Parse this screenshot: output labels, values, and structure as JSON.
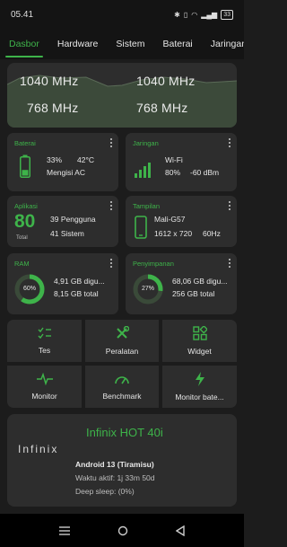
{
  "status_bar": {
    "time": "05.41",
    "icons": [
      "bluetooth-icon",
      "vibrate-icon",
      "wifi-icon",
      "signal-icon",
      "battery-icon"
    ],
    "battery": "33"
  },
  "tabs": [
    {
      "label": "Dasbor",
      "active": true
    },
    {
      "label": "Hardware",
      "active": false
    },
    {
      "label": "Sistem",
      "active": false
    },
    {
      "label": "Baterai",
      "active": false
    },
    {
      "label": "Jaringan",
      "active": false
    }
  ],
  "cpu_freq": {
    "values": [
      "1040 MHz",
      "1040 MHz",
      "768 MHz",
      "768 MHz"
    ]
  },
  "battery_card": {
    "title": "Baterai",
    "percent": "33%",
    "temp": "42°C",
    "status": "Mengisi AC",
    "level": 0.33
  },
  "network_card": {
    "title": "Jaringan",
    "type": "Wi-Fi",
    "signal": "80%",
    "dbm": "-60 dBm"
  },
  "apps_card": {
    "title": "Aplikasi",
    "total": "80",
    "total_label": "Total",
    "user": "39 Pengguna",
    "system": "41 Sistem"
  },
  "display_card": {
    "title": "Tampilan",
    "gpu": "Mali-G57",
    "resolution": "1612 x 720",
    "refresh": "60Hz"
  },
  "ram_card": {
    "title": "RAM",
    "percent": "60%",
    "level": 0.6,
    "used": "4,91 GB digu...",
    "total": "8,15 GB total"
  },
  "storage_card": {
    "title": "Penyimpanan",
    "percent": "27%",
    "level": 0.27,
    "used": "68,06 GB digu...",
    "total": "256 GB total"
  },
  "tools": [
    {
      "label": "Tes",
      "icon": "checklist-icon"
    },
    {
      "label": "Peralatan",
      "icon": "tools-icon"
    },
    {
      "label": "Widget",
      "icon": "widget-icon"
    },
    {
      "label": "Monitor",
      "icon": "pulse-icon"
    },
    {
      "label": "Benchmark",
      "icon": "speedometer-icon"
    },
    {
      "label": "Monitor bate...",
      "icon": "bolt-icon"
    }
  ],
  "device": {
    "brand": "Infinix",
    "model": "Infinix HOT 40i",
    "android": "Android 13 (Tiramisu)",
    "uptime": "Waktu aktif: 1j 33m 50d",
    "deep_sleep": "Deep sleep:  (0%)"
  },
  "colors": {
    "accent": "#3eb34a",
    "card": "#2d2d2d",
    "background": "#1c1c1c"
  }
}
